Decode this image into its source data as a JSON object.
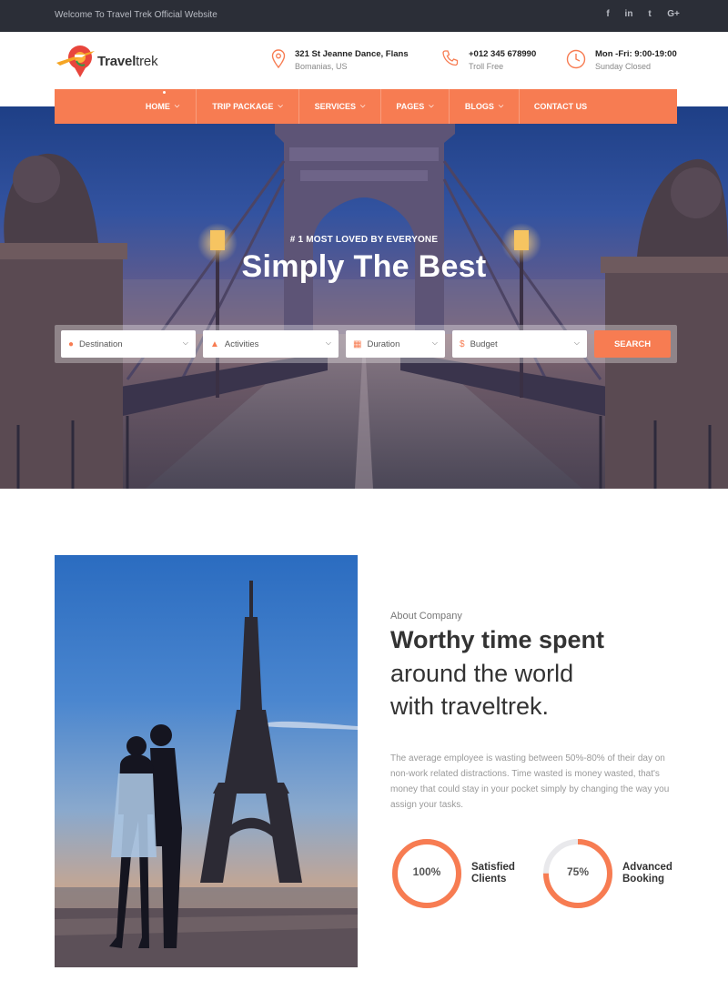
{
  "topbar": {
    "welcome": "Welcome To Travel Trek Official Website",
    "social": [
      "f",
      "in",
      "t",
      "G+"
    ]
  },
  "brand": {
    "name_bold": "Travel",
    "name_rest": "trek"
  },
  "header_info": [
    {
      "icon": "location-pin-icon",
      "line1": "321 St Jeanne Dance, Flans",
      "line2": "Bomanias, US"
    },
    {
      "icon": "phone-icon",
      "line1": "+012 345 678990",
      "line2": "Troll Free"
    },
    {
      "icon": "clock-icon",
      "line1": "Mon -Fri: 9:00-19:00",
      "line2": "Sunday Closed"
    }
  ],
  "nav": {
    "items": [
      {
        "label": "HOME",
        "dropdown": true
      },
      {
        "label": "TRIP PACKAGE",
        "dropdown": true
      },
      {
        "label": "SERVICES",
        "dropdown": true
      },
      {
        "label": "PAGES",
        "dropdown": true
      },
      {
        "label": "BLOGS",
        "dropdown": true
      },
      {
        "label": "CONTACT US",
        "dropdown": false
      }
    ]
  },
  "hero": {
    "subtitle": "# 1 MOST LOVED BY EVERYONE",
    "title": "Simply The Best",
    "search": {
      "destination": "Destination",
      "activities": "Activities",
      "duration": "Duration",
      "budget": "Budget",
      "button": "SEARCH"
    }
  },
  "about": {
    "eyebrow": "About Company",
    "heading_line1": "Worthy time spent",
    "heading_line2": "around the world",
    "heading_line3": "with traveltrek.",
    "paragraph": "The average employee is wasting between 50%-80% of their day on non-work related distractions. Time wasted is money wasted, that's money that could stay in your pocket simply by changing the way you assign your tasks.",
    "stats": [
      {
        "value": 100,
        "display": "100%",
        "label_line1": "Satisfied",
        "label_line2": "Clients"
      },
      {
        "value": 75,
        "display": "75%",
        "label_line1": "Advanced",
        "label_line2": "Booking"
      }
    ]
  },
  "colors": {
    "accent": "#f77c52",
    "topbar": "#2b2e37",
    "text": "#333333"
  }
}
